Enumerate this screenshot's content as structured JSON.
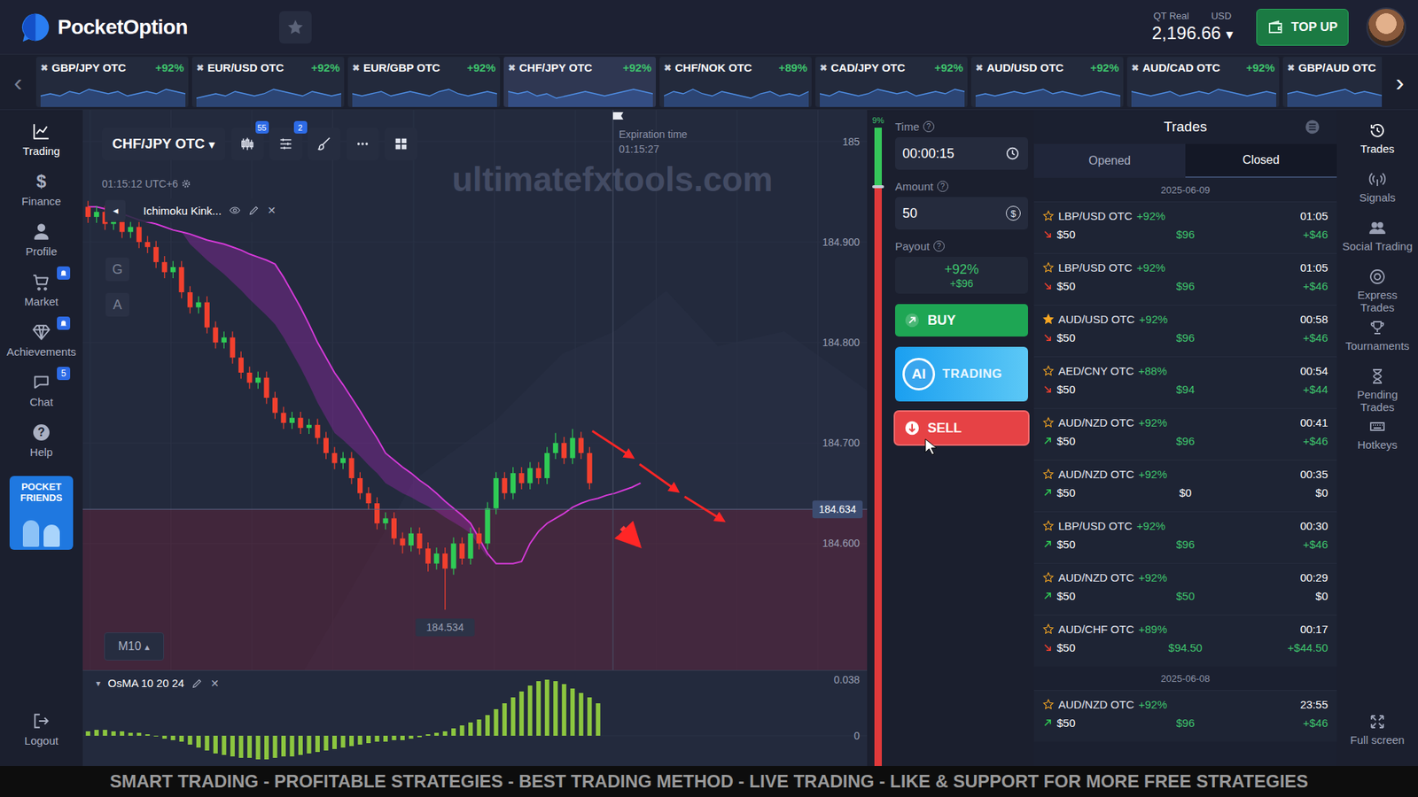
{
  "header": {
    "logo": "PocketOption",
    "account_type": "QT Real",
    "currency": "USD",
    "balance": "2,196.66",
    "balance_caret": "▾",
    "top_up": "TOP UP"
  },
  "ticker": {
    "prev": "‹",
    "next": "›",
    "items": [
      {
        "pair": "GBP/JPY OTC",
        "payout": "+92%",
        "close": "✖",
        "selected": false,
        "spark": [
          5,
          6,
          5,
          7,
          6,
          8,
          7,
          6,
          7,
          5,
          6,
          7,
          6,
          8,
          7,
          6
        ]
      },
      {
        "pair": "EUR/USD OTC",
        "payout": "+92%",
        "close": "✖",
        "selected": false,
        "spark": [
          4,
          5,
          6,
          5,
          7,
          6,
          5,
          6,
          8,
          7,
          6,
          5,
          7,
          6,
          5,
          6
        ]
      },
      {
        "pair": "EUR/GBP OTC",
        "payout": "+92%",
        "close": "✖",
        "selected": false,
        "spark": [
          6,
          5,
          6,
          7,
          5,
          6,
          7,
          6,
          5,
          7,
          8,
          6,
          5,
          6,
          7,
          6
        ]
      },
      {
        "pair": "CHF/JPY OTC",
        "payout": "+92%",
        "close": "✖",
        "selected": true,
        "spark": [
          7,
          6,
          7,
          5,
          6,
          4,
          5,
          6,
          7,
          6,
          5,
          6,
          7,
          8,
          7,
          6
        ]
      },
      {
        "pair": "CHF/NOK OTC",
        "payout": "+89%",
        "close": "✖",
        "selected": false,
        "spark": [
          5,
          7,
          6,
          8,
          6,
          5,
          7,
          6,
          5,
          4,
          6,
          7,
          5,
          6,
          5,
          7
        ]
      },
      {
        "pair": "CAD/JPY OTC",
        "payout": "+92%",
        "close": "✖",
        "selected": false,
        "spark": [
          6,
          5,
          7,
          6,
          5,
          6,
          8,
          7,
          6,
          7,
          5,
          6,
          7,
          6,
          8,
          7
        ]
      },
      {
        "pair": "AUD/USD OTC",
        "payout": "+92%",
        "close": "✖",
        "selected": false,
        "spark": [
          5,
          6,
          5,
          6,
          7,
          6,
          7,
          8,
          6,
          7,
          6,
          5,
          6,
          7,
          6,
          5
        ]
      },
      {
        "pair": "AUD/CAD OTC",
        "payout": "+92%",
        "close": "✖",
        "selected": false,
        "spark": [
          7,
          6,
          5,
          6,
          7,
          5,
          6,
          7,
          6,
          8,
          7,
          6,
          5,
          6,
          7,
          6
        ]
      },
      {
        "pair": "GBP/AUD OTC",
        "close": "✖",
        "selected": false,
        "spark": [
          6,
          7,
          6,
          5,
          6,
          7,
          8,
          6,
          7,
          6,
          5,
          7,
          6,
          5,
          6,
          7
        ]
      }
    ]
  },
  "left_nav": {
    "items": [
      {
        "label": "Trading",
        "selected": true,
        "glyph": "",
        "badge": "",
        "bell": false
      },
      {
        "label": "Finance",
        "selected": false,
        "glyph": "$",
        "badge": "",
        "bell": false
      },
      {
        "label": "Profile",
        "selected": false,
        "glyph": "",
        "badge": "",
        "bell": false
      },
      {
        "label": "Market",
        "selected": false,
        "glyph": "",
        "badge": "",
        "bell": true
      },
      {
        "label": "Achievements",
        "selected": false,
        "glyph": "",
        "badge": "",
        "bell": true
      },
      {
        "label": "Chat",
        "selected": false,
        "glyph": "",
        "badge": "5",
        "bell": false
      },
      {
        "label": "Help",
        "selected": false,
        "glyph": "?",
        "badge": "",
        "bell": false
      }
    ],
    "promo": [
      "POCKET",
      "FRIENDS"
    ],
    "logout": "Logout"
  },
  "chart": {
    "asset": "CHF/JPY OTC",
    "asset_caret": "▾",
    "toolbar_badges": [
      "55",
      "2"
    ],
    "server_time": "01:15:12 UTC+6",
    "watermark": "ultimatefxtools.com",
    "indicator": {
      "collapse": "◂",
      "name": "Ichimoku Kink...",
      "remove": "✕"
    },
    "side_buttons": [
      "G",
      "A"
    ],
    "timeframe": "M10",
    "timeframe_caret": "▴",
    "expiration": {
      "label": "Expiration time",
      "time": "01:15:27"
    },
    "ticks": [
      {
        "label": "185",
        "value": 185
      },
      {
        "label": "184.900",
        "value": 184.9
      },
      {
        "label": "184.800",
        "value": 184.8
      },
      {
        "label": "184.700",
        "value": 184.7
      },
      {
        "label": "184.600",
        "value": 184.6
      }
    ],
    "current_price": {
      "label": "184.634",
      "value": 184.634
    },
    "low_marker": {
      "label": "184.534",
      "value": 184.534,
      "index": 42
    },
    "candles": [
      [
        184.935,
        184.941,
        184.919,
        184.925
      ],
      [
        184.925,
        184.936,
        184.919,
        184.93
      ],
      [
        184.93,
        184.936,
        184.912,
        184.918
      ],
      [
        184.918,
        184.928,
        184.912,
        184.922
      ],
      [
        184.922,
        184.928,
        184.904,
        184.91
      ],
      [
        184.91,
        184.921,
        184.904,
        184.915
      ],
      [
        184.915,
        184.921,
        184.894,
        184.9
      ],
      [
        184.9,
        184.906,
        184.889,
        184.895
      ],
      [
        184.895,
        184.901,
        184.874,
        184.88
      ],
      [
        184.88,
        184.886,
        184.864,
        184.87
      ],
      [
        184.87,
        184.881,
        184.864,
        184.875
      ],
      [
        184.875,
        184.881,
        184.844,
        184.85
      ],
      [
        184.85,
        184.856,
        184.829,
        184.835
      ],
      [
        184.835,
        184.846,
        184.829,
        184.84
      ],
      [
        184.84,
        184.846,
        184.809,
        184.815
      ],
      [
        184.815,
        184.821,
        184.794,
        184.8
      ],
      [
        184.8,
        184.811,
        184.794,
        184.805
      ],
      [
        184.805,
        184.811,
        184.779,
        184.785
      ],
      [
        184.785,
        184.791,
        184.764,
        184.77
      ],
      [
        184.77,
        184.776,
        184.754,
        184.76
      ],
      [
        184.76,
        184.771,
        184.754,
        184.765
      ],
      [
        184.765,
        184.771,
        184.739,
        184.745
      ],
      [
        184.745,
        184.751,
        184.724,
        184.73
      ],
      [
        184.73,
        184.736,
        184.714,
        184.72
      ],
      [
        184.72,
        184.731,
        184.714,
        184.725
      ],
      [
        184.725,
        184.731,
        184.709,
        184.715
      ],
      [
        184.715,
        184.724,
        184.709,
        184.718
      ],
      [
        184.718,
        184.724,
        184.699,
        184.705
      ],
      [
        184.705,
        184.711,
        184.684,
        184.69
      ],
      [
        184.69,
        184.696,
        184.674,
        184.68
      ],
      [
        184.68,
        184.691,
        184.674,
        184.685
      ],
      [
        184.685,
        184.691,
        184.659,
        184.665
      ],
      [
        184.665,
        184.671,
        184.644,
        184.65
      ],
      [
        184.65,
        184.656,
        184.634,
        184.64
      ],
      [
        184.64,
        184.646,
        184.614,
        184.62
      ],
      [
        184.62,
        184.631,
        184.614,
        184.625
      ],
      [
        184.625,
        184.631,
        184.599,
        184.605
      ],
      [
        184.605,
        184.611,
        184.59,
        184.598
      ],
      [
        184.598,
        184.616,
        184.592,
        184.61
      ],
      [
        184.61,
        184.616,
        184.589,
        184.595
      ],
      [
        184.595,
        184.601,
        184.572,
        184.58
      ],
      [
        184.58,
        184.596,
        184.574,
        184.59
      ],
      [
        184.59,
        184.596,
        184.534,
        184.575
      ],
      [
        184.575,
        184.606,
        184.569,
        184.6
      ],
      [
        184.6,
        184.606,
        184.579,
        184.585
      ],
      [
        184.585,
        184.616,
        184.579,
        184.61
      ],
      [
        184.61,
        184.616,
        184.594,
        184.6
      ],
      [
        184.6,
        184.641,
        184.594,
        184.635
      ],
      [
        184.635,
        184.671,
        184.629,
        184.665
      ],
      [
        184.665,
        184.671,
        184.644,
        184.65
      ],
      [
        184.65,
        184.676,
        184.644,
        184.67
      ],
      [
        184.67,
        184.676,
        184.654,
        184.66
      ],
      [
        184.66,
        184.681,
        184.654,
        184.675
      ],
      [
        184.675,
        184.681,
        184.659,
        184.665
      ],
      [
        184.665,
        184.696,
        184.659,
        184.69
      ],
      [
        184.69,
        184.71,
        184.684,
        184.7
      ],
      [
        184.7,
        184.706,
        184.679,
        184.685
      ],
      [
        184.685,
        184.714,
        184.679,
        184.705
      ],
      [
        184.705,
        184.711,
        184.684,
        184.69
      ],
      [
        184.69,
        184.696,
        184.654,
        184.66
      ]
    ],
    "ichimoku_line": [
      184.935,
      184.935,
      184.933,
      184.93,
      184.928,
      184.925,
      184.922,
      184.92,
      184.918,
      184.915,
      184.912,
      184.91,
      184.908,
      184.905,
      184.902,
      184.9,
      184.898,
      184.895,
      184.892,
      184.888,
      184.885,
      184.882,
      184.878,
      184.865,
      184.85,
      184.835,
      184.818,
      184.8,
      184.785,
      184.77,
      184.758,
      184.745,
      184.732,
      184.718,
      184.705,
      184.69,
      184.683,
      184.676,
      184.67,
      184.663,
      184.657,
      184.65,
      184.642,
      184.635,
      184.628,
      184.62,
      184.605,
      184.59,
      184.58,
      184.58,
      184.58,
      184.582,
      184.6,
      184.612,
      184.62,
      184.625,
      184.63,
      184.636,
      184.64,
      184.643,
      184.645,
      184.648,
      184.65,
      184.653,
      184.656,
      184.66
    ],
    "ichimoku_cloud_edge": [
      184.935,
      184.935,
      184.933,
      184.93,
      184.928,
      184.925,
      184.922,
      184.92,
      184.918,
      184.915,
      184.912,
      184.91,
      184.898,
      184.89,
      184.882,
      184.875,
      184.868,
      184.86,
      184.852,
      184.843,
      184.835,
      184.827,
      184.818,
      184.805,
      184.79,
      184.775,
      184.758,
      184.74,
      184.725,
      184.71,
      184.703,
      184.695,
      184.687,
      184.678,
      184.67,
      184.66,
      184.655,
      184.65,
      184.646,
      184.641,
      184.637,
      184.632,
      184.626,
      184.621,
      184.616,
      184.61,
      184.598,
      184.586
    ],
    "osma": {
      "title": "OsMA 10 20 24",
      "collapse": "▾",
      "remove": "✕",
      "ticks": [
        {
          "label": "0.038",
          "value": 0.038
        },
        {
          "label": "0",
          "value": 0
        }
      ],
      "values": [
        0.003,
        0.004,
        0.004,
        0.003,
        0.003,
        0.002,
        0.002,
        0.001,
        0,
        -0.002,
        -0.003,
        -0.004,
        -0.006,
        -0.008,
        -0.01,
        -0.012,
        -0.013,
        -0.014,
        -0.015,
        -0.015,
        -0.016,
        -0.016,
        -0.015,
        -0.014,
        -0.014,
        -0.013,
        -0.012,
        -0.011,
        -0.01,
        -0.009,
        -0.008,
        -0.007,
        -0.006,
        -0.005,
        -0.004,
        -0.004,
        -0.003,
        -0.003,
        -0.002,
        -0.001,
        0.001,
        0.002,
        0.003,
        0.005,
        0.007,
        0.009,
        0.011,
        0.014,
        0.018,
        0.022,
        0.026,
        0.03,
        0.034,
        0.037,
        0.038,
        0.037,
        0.035,
        0.032,
        0.029,
        0.026,
        0.022
      ]
    }
  },
  "meter": {
    "reading": "9%",
    "level": 0.09
  },
  "controls": {
    "help_glyph": "?",
    "time": {
      "label": "Time",
      "value": "00:00:15"
    },
    "amount": {
      "label": "Amount",
      "value": "50",
      "glyph": "$"
    },
    "payout": {
      "label": "Payout",
      "percent": "+92%",
      "value": "+$96"
    },
    "buy": "BUY",
    "ai": {
      "badge": "AI",
      "label": "TRADING"
    },
    "sell": "SELL"
  },
  "trades": {
    "title": "Trades",
    "tabs": [
      {
        "label": "Opened",
        "selected": false
      },
      {
        "label": "Closed",
        "selected": true
      }
    ],
    "groups": [
      {
        "date": "2025-06-09",
        "rows": [
          {
            "pair": "LBP/USD OTC",
            "payout": "+92%",
            "time": "01:05",
            "starred": false,
            "direction": "down",
            "amount": "$50",
            "returned": "$96",
            "profit": "+$46",
            "returned_win": true,
            "profit_win": true
          },
          {
            "pair": "LBP/USD OTC",
            "payout": "+92%",
            "time": "01:05",
            "starred": false,
            "direction": "down",
            "amount": "$50",
            "returned": "$96",
            "profit": "+$46",
            "returned_win": true,
            "profit_win": true
          },
          {
            "pair": "AUD/USD OTC",
            "payout": "+92%",
            "time": "00:58",
            "starred": true,
            "direction": "down",
            "amount": "$50",
            "returned": "$96",
            "profit": "+$46",
            "returned_win": true,
            "profit_win": true
          },
          {
            "pair": "AED/CNY OTC",
            "payout": "+88%",
            "time": "00:54",
            "starred": false,
            "direction": "down",
            "amount": "$50",
            "returned": "$94",
            "profit": "+$44",
            "returned_win": true,
            "profit_win": true
          },
          {
            "pair": "AUD/NZD OTC",
            "payout": "+92%",
            "time": "00:41",
            "starred": false,
            "direction": "up",
            "amount": "$50",
            "returned": "$96",
            "profit": "+$46",
            "returned_win": true,
            "profit_win": true
          },
          {
            "pair": "AUD/NZD OTC",
            "payout": "+92%",
            "time": "00:35",
            "starred": false,
            "direction": "up",
            "amount": "$50",
            "returned": "$0",
            "profit": "$0",
            "returned_win": false,
            "profit_win": false
          },
          {
            "pair": "LBP/USD OTC",
            "payout": "+92%",
            "time": "00:30",
            "starred": false,
            "direction": "up",
            "amount": "$50",
            "returned": "$96",
            "profit": "+$46",
            "returned_win": true,
            "profit_win": true
          },
          {
            "pair": "AUD/NZD OTC",
            "payout": "+92%",
            "time": "00:29",
            "starred": false,
            "direction": "up",
            "amount": "$50",
            "returned": "$50",
            "profit": "$0",
            "returned_win": true,
            "profit_win": false
          },
          {
            "pair": "AUD/CHF OTC",
            "payout": "+89%",
            "time": "00:17",
            "starred": false,
            "direction": "down",
            "amount": "$50",
            "returned": "$94.50",
            "profit": "+$44.50",
            "returned_win": true,
            "profit_win": true
          }
        ]
      },
      {
        "date": "2025-06-08",
        "rows": [
          {
            "pair": "AUD/NZD OTC",
            "payout": "+92%",
            "time": "23:55",
            "starred": false,
            "direction": "up",
            "amount": "$50",
            "returned": "$96",
            "profit": "+$46",
            "returned_win": true,
            "profit_win": true
          }
        ]
      }
    ]
  },
  "right_nav": {
    "items": [
      {
        "label": "Trades",
        "selected": true
      },
      {
        "label": "Signals",
        "selected": false
      },
      {
        "label": "Social Trading",
        "selected": false
      },
      {
        "label": "Express Trades",
        "selected": false
      },
      {
        "label": "Tournaments",
        "selected": false
      },
      {
        "label": "Pending Trades",
        "selected": false
      },
      {
        "label": "Hotkeys",
        "selected": false
      }
    ],
    "fullscreen": "Full screen"
  },
  "banner": "SMART TRADING - PROFITABLE STRATEGIES - BEST TRADING METHOD - LIVE TRADING - LIKE & SUPPORT FOR MORE FREE STRATEGIES"
}
